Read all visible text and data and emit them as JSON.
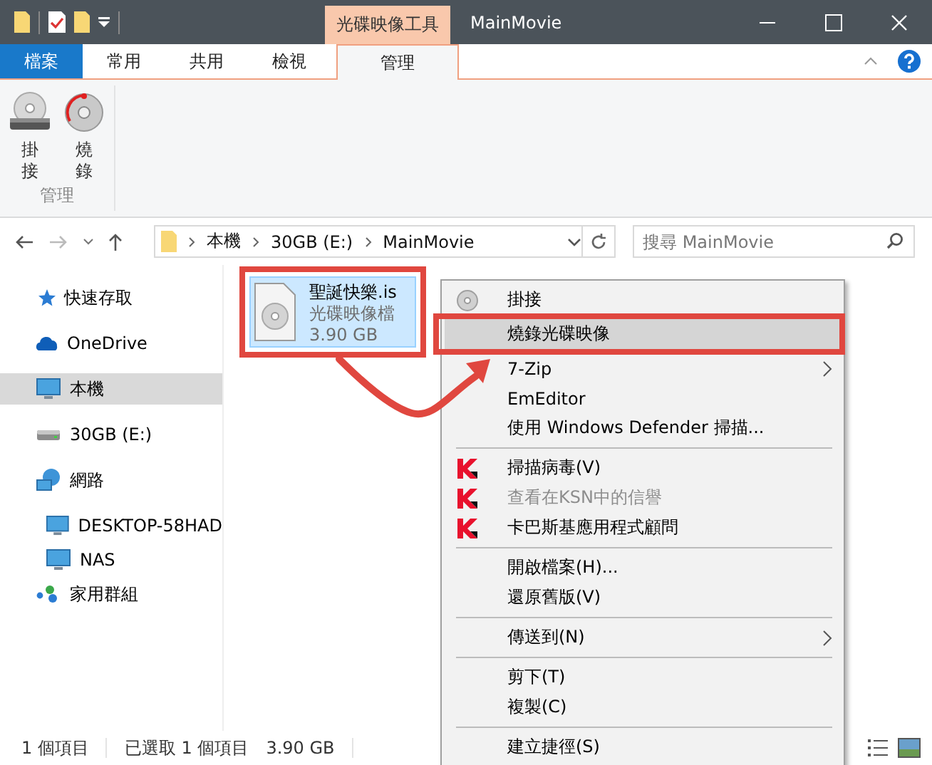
{
  "window": {
    "title": "MainMovie",
    "contextual_group": "光碟映像工具"
  },
  "ribbon": {
    "tabs": [
      {
        "label": "檔案",
        "kind": "file",
        "selected": false
      },
      {
        "label": "常用",
        "kind": "normal",
        "selected": false
      },
      {
        "label": "共用",
        "kind": "normal",
        "selected": false
      },
      {
        "label": "檢視",
        "kind": "normal",
        "selected": false
      },
      {
        "label": "管理",
        "kind": "contextual",
        "selected": true
      }
    ],
    "buttons": [
      {
        "label": "掛接"
      },
      {
        "label": "燒錄"
      }
    ],
    "group_label": "管理"
  },
  "address": {
    "path": [
      "本機",
      "30GB (E:)",
      "MainMovie"
    ]
  },
  "search": {
    "placeholder": "搜尋 MainMovie"
  },
  "nav": [
    {
      "label": "快速存取",
      "selected": false
    },
    {
      "label": "OneDrive",
      "selected": false
    },
    {
      "label": "本機",
      "selected": true
    },
    {
      "label": "30GB (E:)",
      "selected": false
    },
    {
      "label": "網路",
      "selected": false,
      "children": [
        {
          "label": "DESKTOP-58HAD",
          "selected": false
        },
        {
          "label": "NAS",
          "selected": false
        }
      ]
    },
    {
      "label": "家用群組",
      "selected": false
    }
  ],
  "files": [
    {
      "name": "聖誕快樂.is",
      "type": "光碟映像檔",
      "size": "3.90 GB",
      "selected": true,
      "annotated": true
    }
  ],
  "context_menu": [
    {
      "kind": "disc-item",
      "label": "掛接",
      "selected": false,
      "disabled": false,
      "submenu": false,
      "annotated": false
    },
    {
      "kind": "item",
      "label": "燒錄光碟映像",
      "selected": true,
      "disabled": false,
      "submenu": false,
      "annotated": true
    },
    {
      "kind": "item",
      "label": "7-Zip",
      "selected": false,
      "disabled": false,
      "submenu": true,
      "annotated": false
    },
    {
      "kind": "item",
      "label": "EmEditor",
      "selected": false,
      "disabled": false,
      "submenu": false,
      "annotated": false
    },
    {
      "kind": "item",
      "label": "使用 Windows Defender 掃描...",
      "selected": false,
      "disabled": false,
      "submenu": false,
      "annotated": false
    },
    {
      "kind": "separator"
    },
    {
      "kind": "k-logo-item",
      "label": "掃描病毒(V)",
      "selected": false,
      "disabled": false,
      "submenu": false,
      "annotated": false
    },
    {
      "kind": "k-logo-item",
      "label": "查看在KSN中的信譽",
      "selected": false,
      "disabled": true,
      "submenu": false,
      "annotated": false
    },
    {
      "kind": "k-logo-item",
      "label": "卡巴斯基應用程式顧問",
      "selected": false,
      "disabled": false,
      "submenu": false,
      "annotated": false
    },
    {
      "kind": "separator"
    },
    {
      "kind": "item",
      "label": "開啟檔案(H)...",
      "selected": false,
      "disabled": false,
      "submenu": false,
      "annotated": false
    },
    {
      "kind": "item",
      "label": "還原舊版(V)",
      "selected": false,
      "disabled": false,
      "submenu": false,
      "annotated": false
    },
    {
      "kind": "separator"
    },
    {
      "kind": "item",
      "label": "傳送到(N)",
      "selected": false,
      "disabled": false,
      "submenu": true,
      "annotated": false
    },
    {
      "kind": "separator"
    },
    {
      "kind": "item",
      "label": "剪下(T)",
      "selected": false,
      "disabled": false,
      "submenu": false,
      "annotated": false
    },
    {
      "kind": "item",
      "label": "複製(C)",
      "selected": false,
      "disabled": false,
      "submenu": false,
      "annotated": false
    },
    {
      "kind": "separator"
    },
    {
      "kind": "item",
      "label": "建立捷徑(S)",
      "selected": false,
      "disabled": false,
      "submenu": false,
      "annotated": false
    }
  ],
  "status_bar": {
    "item_count": "1 個項目",
    "selection": "已選取 1 個項目",
    "selection_size": "3.90 GB"
  }
}
